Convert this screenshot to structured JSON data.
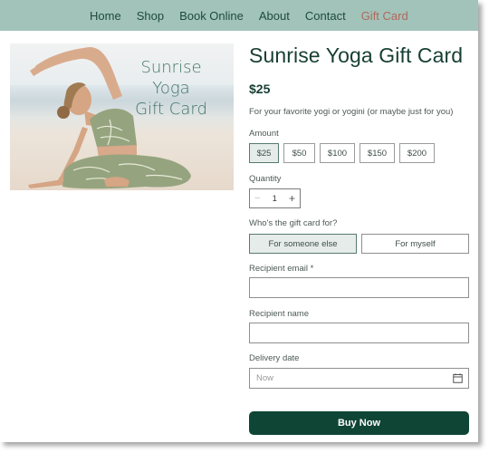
{
  "nav": {
    "items": [
      {
        "label": "Home"
      },
      {
        "label": "Shop"
      },
      {
        "label": "Book Online"
      },
      {
        "label": "About"
      },
      {
        "label": "Contact"
      },
      {
        "label": "Gift Card",
        "active": true
      }
    ]
  },
  "hero": {
    "overlay_lines": [
      "Sunrise",
      "Yoga",
      "Gift Card"
    ],
    "alt": "Woman in sage-green patterned yoga outfit doing a side stretch on the beach"
  },
  "product": {
    "title": "Sunrise Yoga Gift Card",
    "price": "$25",
    "description": "For your favorite yogi or yogini (or maybe just for you)"
  },
  "amount": {
    "label": "Amount",
    "options": [
      "$25",
      "$50",
      "$100",
      "$150",
      "$200"
    ],
    "selected": "$25"
  },
  "quantity": {
    "label": "Quantity",
    "value": "1",
    "minus": "−",
    "plus": "+"
  },
  "recipient_type": {
    "label": "Who's the gift card for?",
    "options": [
      "For someone else",
      "For myself"
    ],
    "selected": "For someone else"
  },
  "fields": {
    "email": {
      "label": "Recipient email",
      "required_mark": "*",
      "value": ""
    },
    "name": {
      "label": "Recipient name",
      "value": ""
    },
    "delivery": {
      "label": "Delivery date",
      "placeholder": "Now",
      "icon": "calendar-icon"
    }
  },
  "buy_button": {
    "label": "Buy Now"
  },
  "colors": {
    "nav_bg": "#a2c3b9",
    "nav_text": "#1d4a3c",
    "nav_active": "#b0685d",
    "brand_dark": "#0f4535",
    "selected_bg": "#e5ecea"
  }
}
